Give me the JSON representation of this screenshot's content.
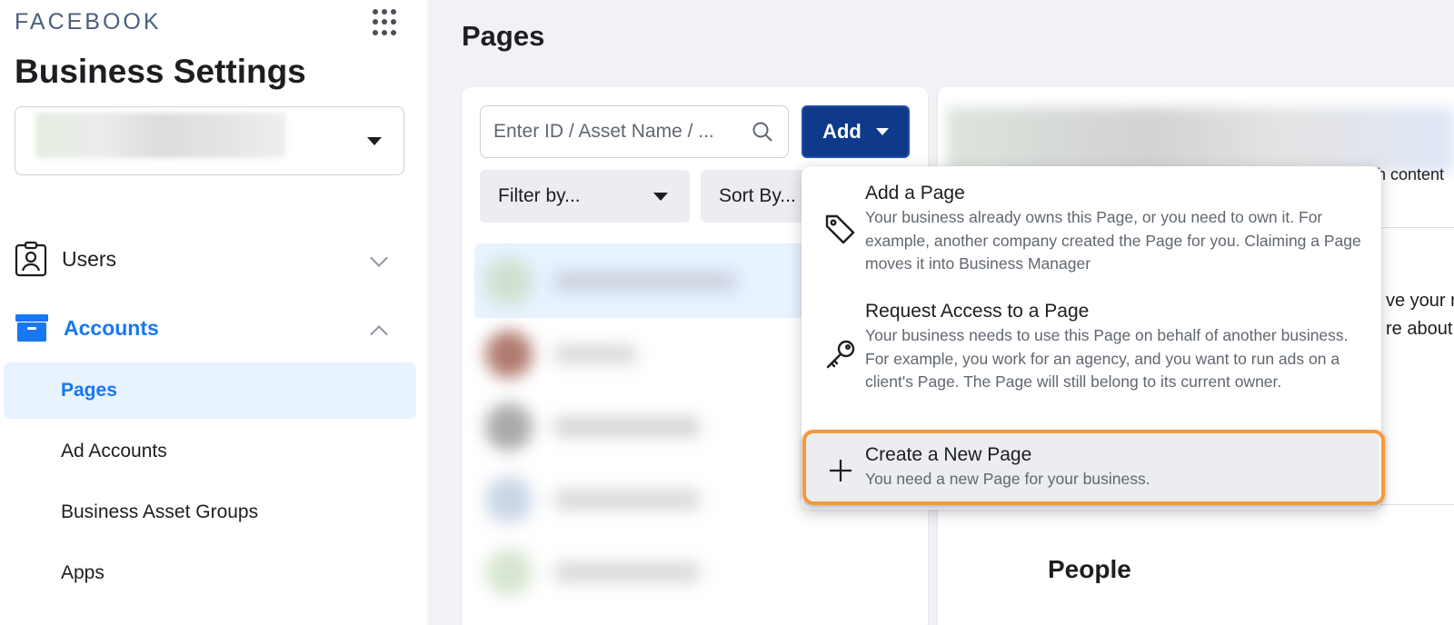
{
  "sidebar": {
    "brand": "FACEBOOK",
    "title": "Business Settings",
    "nav": {
      "users": "Users",
      "accounts": "Accounts"
    },
    "sub_items": {
      "pages": "Pages",
      "ad_accounts": "Ad Accounts",
      "business_asset_groups": "Business Asset Groups",
      "apps": "Apps"
    }
  },
  "main": {
    "heading": "Pages",
    "search": {
      "placeholder": "Enter ID / Asset Name / ..."
    },
    "add_button": "Add",
    "filter_button": "Filter by...",
    "sort_button": "Sort By..."
  },
  "add_menu": {
    "items": [
      {
        "title": "Add a Page",
        "description": "Your business already owns this Page, or you need to own it. For example, another company created the Page for you. Claiming a Page moves it into Business Manager",
        "icon": "tag-icon"
      },
      {
        "title": "Request Access to a Page",
        "description": "Your business needs to use this Page on behalf of another business. For example, you work for an agency, and you want to run ads on a client's Page. The Page will still belong to its current owner.",
        "icon": "key-icon"
      },
      {
        "title": "Create a New Page",
        "description": "You need a new Page for your business.",
        "icon": "plus-icon"
      }
    ]
  },
  "detail": {
    "frag_content": "h content",
    "frag_line1": "ve your n",
    "frag_line2": "re about",
    "people_heading": "People"
  },
  "colors": {
    "accent": "#1877f2",
    "add_button_bg": "#0f3a8a",
    "highlight_border": "#f59a3c",
    "selected_bg": "#e7f3ff"
  }
}
